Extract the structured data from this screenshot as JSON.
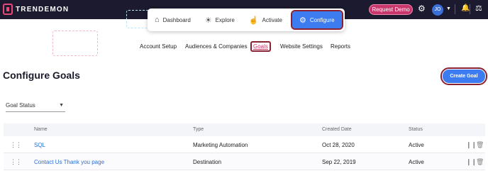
{
  "brand": {
    "logo_text": "TRENDEMON"
  },
  "topbar": {
    "request_demo": "Request Demo",
    "avatar_initials": "JO"
  },
  "modules": [
    {
      "label": "Dashboard",
      "icon": "home-icon"
    },
    {
      "label": "Explore",
      "icon": "lightbulb-icon"
    },
    {
      "label": "Activate",
      "icon": "click-icon"
    },
    {
      "label": "Configure",
      "icon": "gears-icon",
      "active": true
    }
  ],
  "subnav": [
    {
      "label": "Account Setup"
    },
    {
      "label": "Audiences & Companies"
    },
    {
      "label": "Goals",
      "active": true
    },
    {
      "label": "Website Settings"
    },
    {
      "label": "Reports"
    }
  ],
  "page": {
    "title": "Configure Goals",
    "create_button": "Create Goal",
    "filter_label": "Goal Status"
  },
  "table": {
    "columns": [
      "Name",
      "Type",
      "Created Date",
      "Status"
    ],
    "rows": [
      {
        "name": "SQL",
        "type": "Marketing Automation",
        "created": "Oct 28, 2020",
        "status": "Active"
      },
      {
        "name": "Contact Us Thank you page",
        "type": "Destination",
        "created": "Sep 22, 2019",
        "status": "Active"
      }
    ]
  },
  "colors": {
    "topbar": "#1b1a2e",
    "accent_blue": "#3d7cf0",
    "brand_pink": "#c8366a",
    "highlight_outline": "#8a2130"
  }
}
